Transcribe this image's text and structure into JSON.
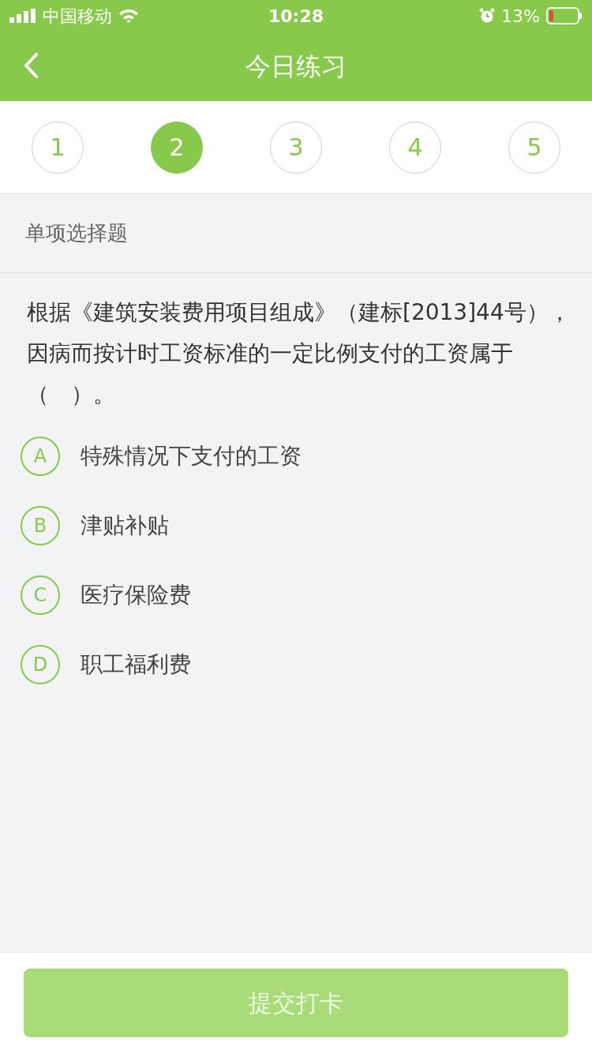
{
  "status_bar": {
    "carrier": "中国移动",
    "time": "10:28",
    "battery": "13%"
  },
  "header": {
    "title": "今日练习"
  },
  "question_tabs": [
    {
      "label": "1",
      "selected": false
    },
    {
      "label": "2",
      "selected": true
    },
    {
      "label": "3",
      "selected": false
    },
    {
      "label": "4",
      "selected": false
    },
    {
      "label": "5",
      "selected": false
    }
  ],
  "question_type": "单项选择题",
  "question": "根据《建筑安装费用项目组成》（建标[2013]44号），因病而按计时工资标准的一定比例支付的工资属于（　）。",
  "options": [
    {
      "letter": "A",
      "text": "特殊情况下支付的工资",
      "selected": false
    },
    {
      "letter": "B",
      "text": "津贴补贴",
      "selected": false
    },
    {
      "letter": "C",
      "text": "医疗保险费",
      "selected": false
    },
    {
      "letter": "D",
      "text": "职工福利费",
      "selected": false
    }
  ],
  "submit_button": {
    "label": "提交打卡",
    "disabled": true
  }
}
